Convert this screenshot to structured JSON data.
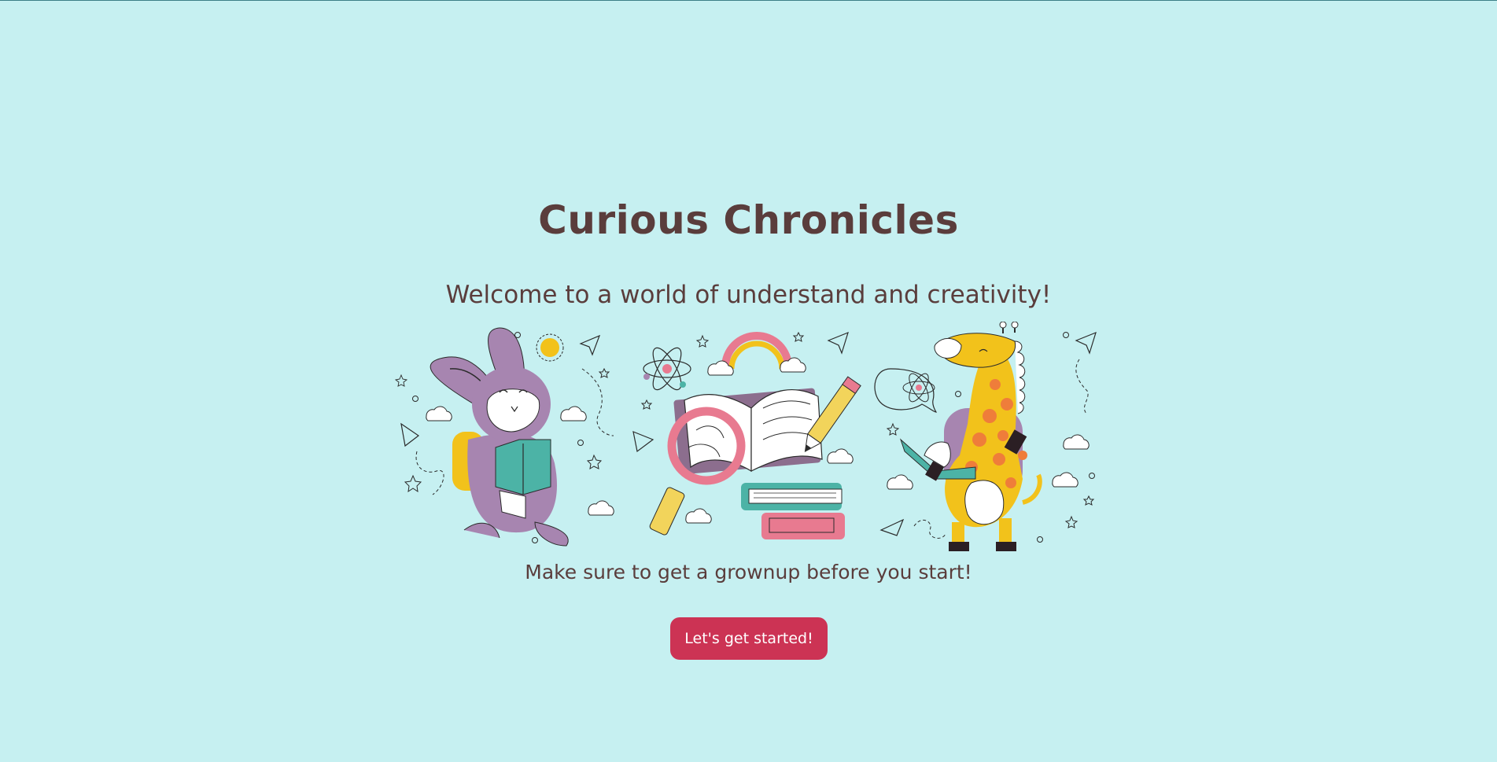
{
  "app": {
    "title": "Curious Chronicles"
  },
  "welcome": {
    "subtitle": "Welcome to a world of understand and creativity!",
    "notice": "Make sure to get a grownup before you start!",
    "cta_label": "Let's get started!"
  },
  "illustration": {
    "icons": [
      "rabbit-reading-icon",
      "book-magnifier-icon",
      "giraffe-backpack-icon",
      "sun-icon",
      "rainbow-icon",
      "atom-icon",
      "paper-plane-icon",
      "cloud-icon",
      "pencil-icon",
      "star-icon"
    ]
  },
  "colors": {
    "background": "#c6f0f1",
    "text": "#5a3d3c",
    "accent": "#cc3354",
    "purple": "#a785b0",
    "yellow": "#f2c21b",
    "teal": "#4cb3a6",
    "pink": "#e87a90",
    "orange": "#ef7d3a"
  }
}
